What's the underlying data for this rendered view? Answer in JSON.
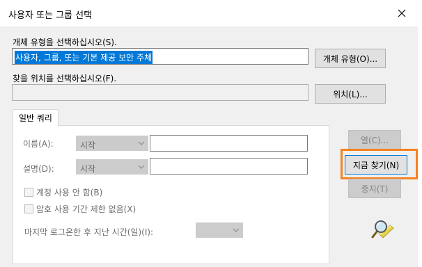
{
  "dialog": {
    "title": "사용자 또는 그룹 선택",
    "close_icon": "close-icon"
  },
  "object_type": {
    "label": "개체 유형을 선택하십시오(S).",
    "value": "사용자, 그룹, 또는 기본 제공 보안 주체",
    "button": "개체 유형(O)..."
  },
  "location": {
    "label": "찾을 위치를 선택하십시오(F).",
    "value": "",
    "button": "위치(L)..."
  },
  "tabs": {
    "general_query": "일반 쿼리"
  },
  "query": {
    "name_label": "이름(A):",
    "name_mode": "시작",
    "name_value": "",
    "desc_label": "설명(D):",
    "desc_mode": "시작",
    "desc_value": "",
    "disabled_accounts": "계정 사용 안 함(B)",
    "non_expiring_password": "암호 사용 기간 제한 없음(X)",
    "days_since_logon_label": "마지막 로그온한 후 지난 시간(일)(I):",
    "days_since_logon_value": ""
  },
  "buttons": {
    "columns": "열(C)...",
    "find_now": "지금 찾기(N)",
    "stop": "중지(T)"
  },
  "icons": {
    "search_graphic": "search-magnifier-icon"
  },
  "colors": {
    "selection": "#0078d7",
    "highlight": "#f58220",
    "dialog_bg": "#f0f0f0"
  }
}
